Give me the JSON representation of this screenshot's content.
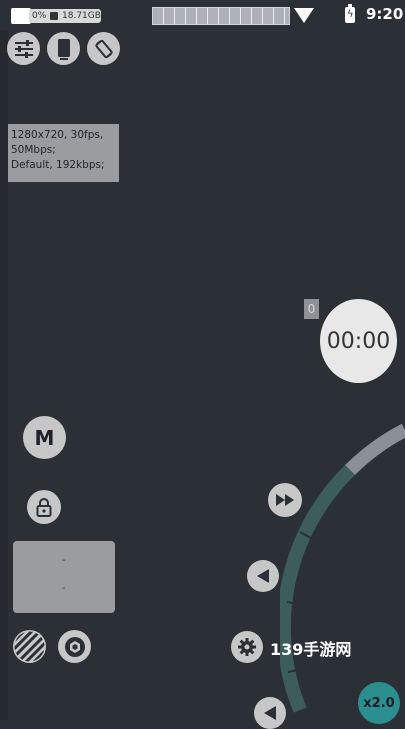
{
  "status_bar": {
    "battery_percent": "0%",
    "storage": "18.71GB",
    "time": "9:20"
  },
  "toolbar": {
    "icons": [
      "sliders-icon",
      "phone-icon",
      "rotate-icon"
    ]
  },
  "settings_info": {
    "lines": [
      "1280x720, 30fps,",
      "50Mbps;",
      "Default, 192kbps;"
    ]
  },
  "recording": {
    "counter": "0",
    "timer": "00:00"
  },
  "controls": {
    "mode_label": "M",
    "panel_dots": [
      "-",
      "-"
    ],
    "zoom_label": "x2.0"
  },
  "watermark": "139手游网"
}
